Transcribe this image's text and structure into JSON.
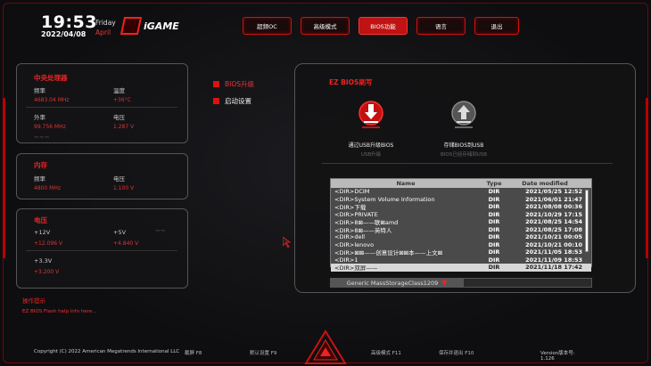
{
  "header": {
    "time": "19:53",
    "date": "2022/04/08",
    "day": "Friday",
    "month": "April",
    "brand": "iGAME"
  },
  "nav": [
    "超频OC",
    "高级模式",
    "BIOS功能",
    "语言",
    "退出"
  ],
  "nav_active_index": 2,
  "cpu_panel": {
    "title": "中央处理器",
    "freq_label": "频率",
    "freq_value": "4683.04 MHz",
    "temp_label": "温度",
    "temp_value": "+36°C",
    "bclk_label": "外率",
    "bclk_value": "99.756 MHz",
    "volt_label": "电压",
    "volt_value": "1.287 V"
  },
  "mem_panel": {
    "title": "内存",
    "freq_label": "频率",
    "freq_value": "4800 MHz",
    "volt_label": "电压",
    "volt_value": "1.100 V"
  },
  "volt_panel": {
    "title": "电压",
    "v12_label": "+12V",
    "v12_value": "+12.096 V",
    "v5_label": "+5V",
    "v5_value": "+4.840 V",
    "v33_label": "+3.3V",
    "v33_value": "+3.200 V"
  },
  "tip": {
    "title": "操作提示",
    "text": "EZ BIOS Flash help info here..."
  },
  "side_menu": {
    "bios_update": "BIOS升级",
    "boot_settings": "启动设置"
  },
  "main": {
    "title": "EZ BIOS刷写",
    "usb_flash_label": "通过USB升级BIOS",
    "usb_flash_sub": "USB升级",
    "save_bios_label": "存储BIOS到USB",
    "save_bios_sub": "BIOS已经存储到USB"
  },
  "file_table": {
    "headers": {
      "name": "Name",
      "type": "Type",
      "date": "Date modified"
    },
    "rows": [
      {
        "name": "<DIR>DCIM",
        "type": "DIR",
        "date": "2021/05/25 12:52"
      },
      {
        "name": "<DIR>System Volume Information",
        "type": "DIR",
        "date": "2021/06/01 21:47"
      },
      {
        "name": "<DIR>下载",
        "type": "DIR",
        "date": "2021/08/08 00:36"
      },
      {
        "name": "<DIR>PRIVATE",
        "type": "DIR",
        "date": "2021/10/29 17:15"
      },
      {
        "name": "<DIR>8⊠——联⊠amd",
        "type": "DIR",
        "date": "2021/08/25 14:54"
      },
      {
        "name": "<DIR>8⊠——英特人",
        "type": "DIR",
        "date": "2021/08/25 17:08"
      },
      {
        "name": "<DIR>dell",
        "type": "DIR",
        "date": "2021/10/21 00:05"
      },
      {
        "name": "<DIR>lenovo",
        "type": "DIR",
        "date": "2021/10/21 00:10"
      },
      {
        "name": "<DIR>⊠⊠——创意设计⊠⊠本——上文⊠",
        "type": "DIR",
        "date": "2021/11/05 18:53"
      },
      {
        "name": "<DIR>1",
        "type": "DIR",
        "date": "2021/11/09 18:53"
      },
      {
        "name": "<DIR>双屏——",
        "type": "DIR",
        "date": "2021/11/18 17:42"
      }
    ]
  },
  "device": "Generic MassStorageClass1209",
  "footer": {
    "copyright": "Copyright (C) 2022 American Megatrends International LLC",
    "f8": "截屏 F8",
    "f9": "默认设置 F9",
    "f11": "高级模式 F11",
    "f10": "保存并退出 F10",
    "version": "Version版本号: 1.126"
  },
  "colors": {
    "accent": "#d11414",
    "panel_border": "#555555"
  }
}
